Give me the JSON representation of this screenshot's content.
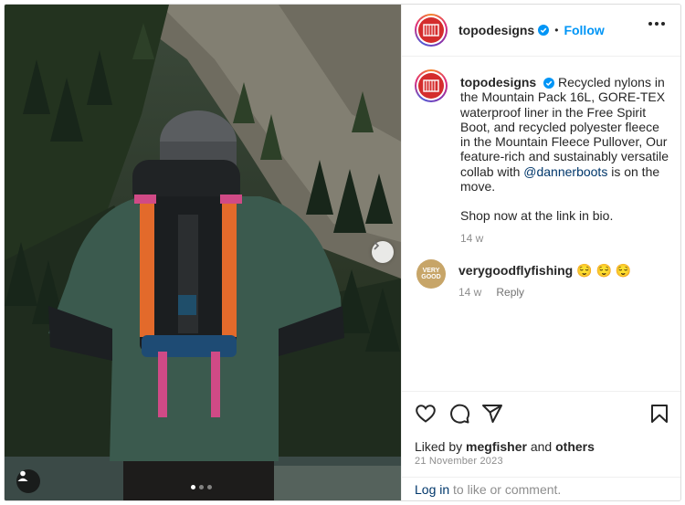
{
  "post": {
    "author": "topodesigns",
    "follow_label": "Follow",
    "bullet": "•",
    "caption": {
      "author": "topodesigns",
      "text_before_mention": "Recycled nylons in the Mountain Pack 16L, GORE-TEX waterproof liner in the Free Spirit Boot, and recycled polyester fleece in the Mountain Fleece Pullover, Our feature-rich and sustainably versatile collab with ",
      "mention": "@dannerboots",
      "text_after_mention": " is on the move.",
      "second_paragraph": "Shop now at the link in bio.",
      "time": "14 w"
    },
    "comments": [
      {
        "author": "verygoodflyfishing",
        "text": "😌 😌 😌",
        "time": "14 w",
        "reply_label": "Reply",
        "avatar_text_top": "VERY",
        "avatar_text_bottom": "GOOD"
      }
    ],
    "likes": {
      "prefix": "Liked by ",
      "user": "megfisher",
      "middle": " and ",
      "others": "others"
    },
    "date": "21 November 2023",
    "login": {
      "link": "Log in",
      "rest": " to like or comment."
    },
    "carousel": {
      "total": 3,
      "active": 1
    }
  },
  "colors": {
    "follow_blue": "#0095f6",
    "mention_blue": "#00376b",
    "brand_red": "#d42d2d",
    "muted_text": "#8e8e8e"
  },
  "icons": [
    "verified-badge-icon",
    "more-options-icon",
    "heart-icon",
    "comment-icon",
    "share-icon",
    "bookmark-icon",
    "next-arrow-icon",
    "user-tag-icon"
  ]
}
